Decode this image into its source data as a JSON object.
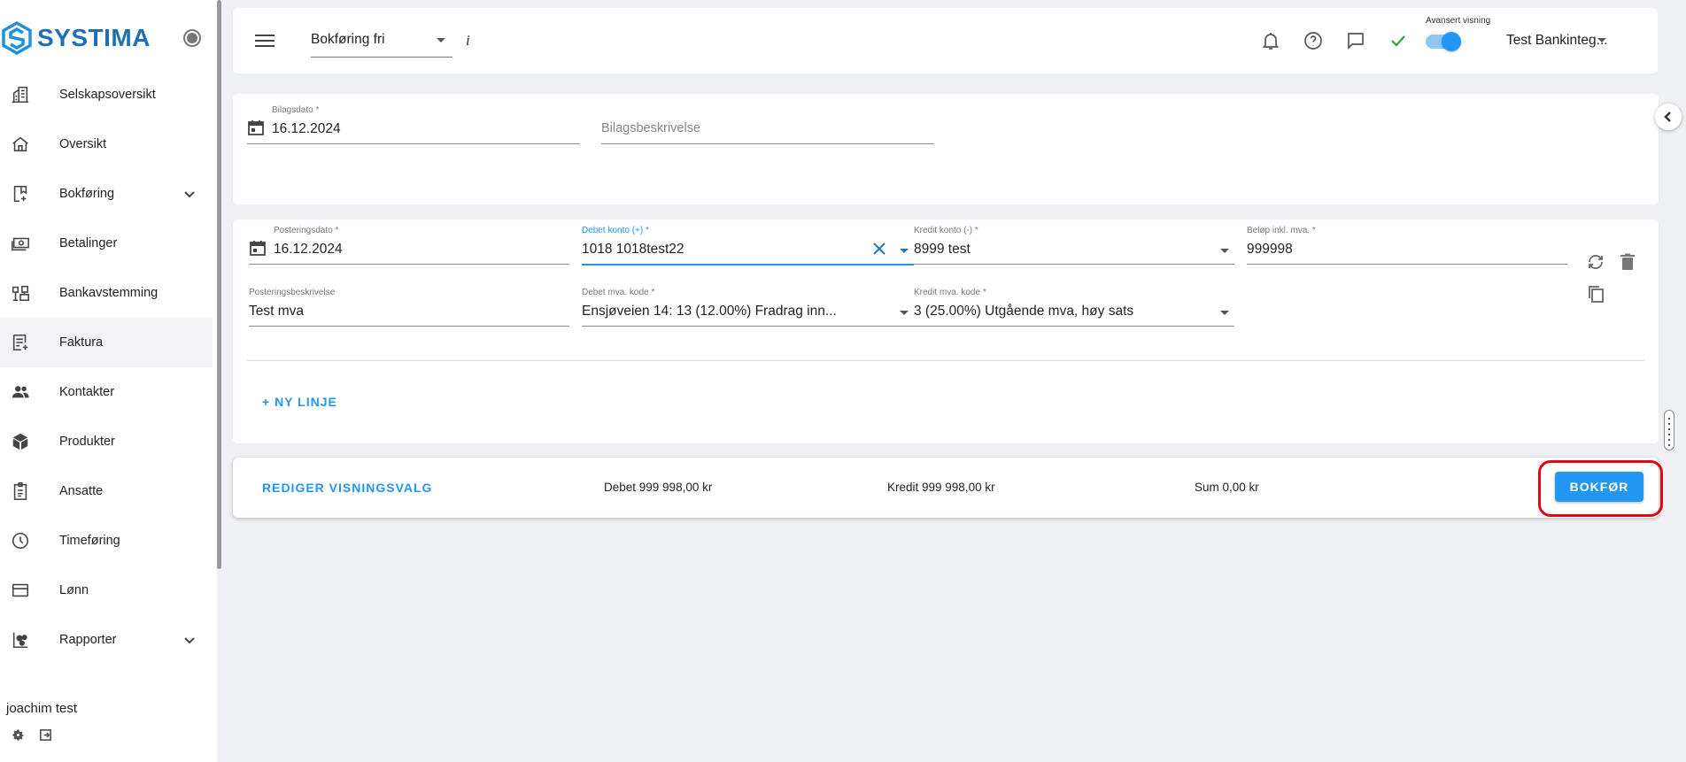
{
  "brand": {
    "name": "SYSTIMA"
  },
  "sidebar": {
    "items": [
      {
        "label": "Selskapsoversikt",
        "icon": "company-building-icon"
      },
      {
        "label": "Oversikt",
        "icon": "home-icon"
      },
      {
        "label": "Bokføring",
        "icon": "bookkeeping-icon",
        "expandable": true
      },
      {
        "label": "Betalinger",
        "icon": "payments-icon"
      },
      {
        "label": "Bankavstemming",
        "icon": "bank-reconcile-icon"
      },
      {
        "label": "Faktura",
        "icon": "invoice-icon",
        "active": true
      },
      {
        "label": "Kontakter",
        "icon": "contacts-icon"
      },
      {
        "label": "Produkter",
        "icon": "product-box-icon"
      },
      {
        "label": "Ansatte",
        "icon": "employee-badge-icon"
      },
      {
        "label": "Timeføring",
        "icon": "clock-icon"
      },
      {
        "label": "Lønn",
        "icon": "credit-card-icon"
      },
      {
        "label": "Rapporter",
        "icon": "reports-icon",
        "expandable": true
      }
    ],
    "user": {
      "name": "joachim test"
    }
  },
  "header": {
    "mode_select": "Bokføring fri",
    "info_label": "i",
    "advanced_label": "Avansert visning",
    "advanced_enabled": true,
    "company": "Test Bankinteg..."
  },
  "voucher": {
    "date_label": "Bilagsdato *",
    "date_value": "16.12.2024",
    "description_placeholder": "Bilagsbeskrivelse"
  },
  "line": {
    "posting_date_label": "Posteringsdato *",
    "posting_date_value": "16.12.2024",
    "debit_label": "Debet konto (+) *",
    "debit_value": "1018 1018test22",
    "credit_label": "Kredit konto (-) *",
    "credit_value": "8999 test",
    "amount_label": "Beløp inkl. mva. *",
    "amount_value": "999998",
    "posting_desc_label": "Posteringsbeskrivelse",
    "posting_desc_value": "Test mva",
    "debit_vat_label": "Debet mva. kode *",
    "debit_vat_value": "Ensjøveien 14: 13 (12.00%) Fradrag inn...",
    "credit_vat_label": "Kredit mva. kode *",
    "credit_vat_value": "3 (25.00%) Utgående mva, høy sats"
  },
  "actions": {
    "new_line": "+ NY LINJE",
    "edit_view": "REDIGER VISNINGSVALG",
    "debit_total": "Debet 999 998,00 kr",
    "credit_total": "Kredit 999 998,00 kr",
    "sum_total": "Sum 0,00 kr",
    "book": "BOKFØR"
  },
  "colors": {
    "accent": "#2196f3",
    "brand": "#1f6fb8",
    "highlight": "#e30613"
  }
}
